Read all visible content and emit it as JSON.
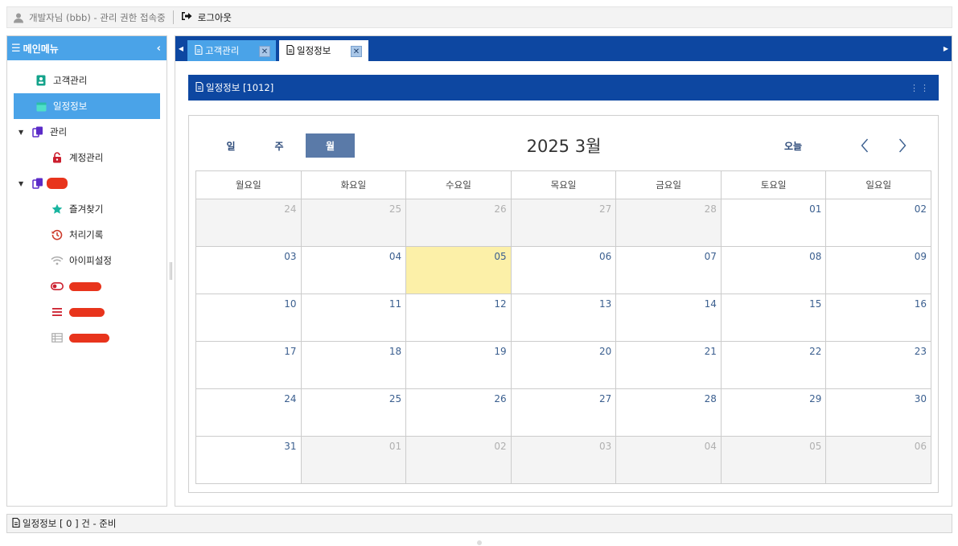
{
  "topbar": {
    "user_text": "개발자님 (bbb) - 관리 권한 접속중",
    "logout_label": "로그아웃"
  },
  "sidebar": {
    "title": "메인메뉴",
    "items": [
      {
        "label": "고객관리",
        "icon": "contact-card-icon",
        "color": "#14a38b"
      },
      {
        "label": "일정정보",
        "icon": "calendar-icon",
        "color": "#4ee0c8",
        "active": true
      },
      {
        "label": "관리",
        "icon": "copy-folder-icon",
        "color": "#5b2bc8",
        "group": true
      },
      {
        "label": "계정관리",
        "icon": "unlock-icon",
        "color": "#cc1f2e"
      },
      {
        "label": "즐겨찾기",
        "icon": "star-icon",
        "color": "#19b5a0"
      },
      {
        "label": "처리기록",
        "icon": "history-icon",
        "color": "#cc3a2a"
      },
      {
        "label": "아이피설정",
        "icon": "wifi-icon",
        "color": "#aaaaaa"
      },
      {
        "icon": "toggle-icon",
        "color": "#cc1f2e"
      },
      {
        "icon": "list-icon",
        "color": "#cc1f2e"
      },
      {
        "icon": "table-icon",
        "color": "#aaaaaa"
      }
    ]
  },
  "tabs": [
    {
      "label": "고객관리"
    },
    {
      "label": "일정정보"
    }
  ],
  "panel": {
    "title": "일정정보 [1012]"
  },
  "calendar": {
    "view_buttons": [
      "일",
      "주",
      "월"
    ],
    "selected_view": "월",
    "title": "2025 3월",
    "today_label": "오늘",
    "weekdays": [
      "월요일",
      "화요일",
      "수요일",
      "목요일",
      "금요일",
      "토요일",
      "일요일"
    ],
    "days": [
      {
        "d": "24",
        "other": true
      },
      {
        "d": "25",
        "other": true
      },
      {
        "d": "26",
        "other": true
      },
      {
        "d": "27",
        "other": true
      },
      {
        "d": "28",
        "other": true
      },
      {
        "d": "01"
      },
      {
        "d": "02"
      },
      {
        "d": "03"
      },
      {
        "d": "04"
      },
      {
        "d": "05",
        "today": true
      },
      {
        "d": "06"
      },
      {
        "d": "07"
      },
      {
        "d": "08"
      },
      {
        "d": "09"
      },
      {
        "d": "10"
      },
      {
        "d": "11"
      },
      {
        "d": "12"
      },
      {
        "d": "13"
      },
      {
        "d": "14"
      },
      {
        "d": "15"
      },
      {
        "d": "16"
      },
      {
        "d": "17"
      },
      {
        "d": "18"
      },
      {
        "d": "19"
      },
      {
        "d": "20"
      },
      {
        "d": "21"
      },
      {
        "d": "22"
      },
      {
        "d": "23"
      },
      {
        "d": "24"
      },
      {
        "d": "25"
      },
      {
        "d": "26"
      },
      {
        "d": "27"
      },
      {
        "d": "28"
      },
      {
        "d": "29"
      },
      {
        "d": "30"
      },
      {
        "d": "31"
      },
      {
        "d": "01",
        "other": true
      },
      {
        "d": "02",
        "other": true
      },
      {
        "d": "03",
        "other": true
      },
      {
        "d": "04",
        "other": true
      },
      {
        "d": "05",
        "other": true
      },
      {
        "d": "06",
        "other": true
      }
    ]
  },
  "status": {
    "text": "일정정보 [ 0 ] 건 - 준비"
  },
  "colors": {
    "accent": "#4aa3e8",
    "navy": "#0d47a1",
    "today": "#fcf0a8",
    "month_button": "#5a7aa8"
  }
}
